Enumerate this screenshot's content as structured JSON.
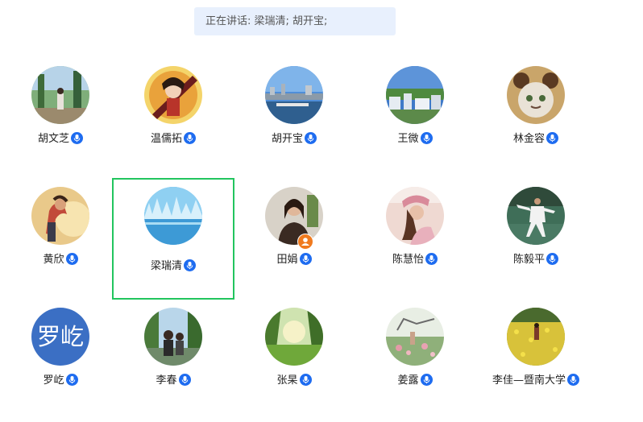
{
  "speaking": {
    "text": "正在讲话: 梁瑞清; 胡开宝;"
  },
  "participants": [
    {
      "name": "胡文芝"
    },
    {
      "name": "温儒拓"
    },
    {
      "name": "胡开宝"
    },
    {
      "name": "王微"
    },
    {
      "name": "林金容"
    },
    {
      "name": "黄欣"
    },
    {
      "name": "梁瑞清"
    },
    {
      "name": "田娟"
    },
    {
      "name": "陈慧怡"
    },
    {
      "name": "陈毅平"
    },
    {
      "name": "罗屹",
      "avatar_text": "罗屹"
    },
    {
      "name": "李春"
    },
    {
      "name": "张杲"
    },
    {
      "name": "姜露"
    },
    {
      "name": "李佳—暨南大学"
    }
  ],
  "colors": {
    "accent": "#1e6cf0",
    "selected_border": "#22c55e",
    "speaking_bar_bg": "#e8f0fd",
    "host_badge": "#f07a1e"
  }
}
